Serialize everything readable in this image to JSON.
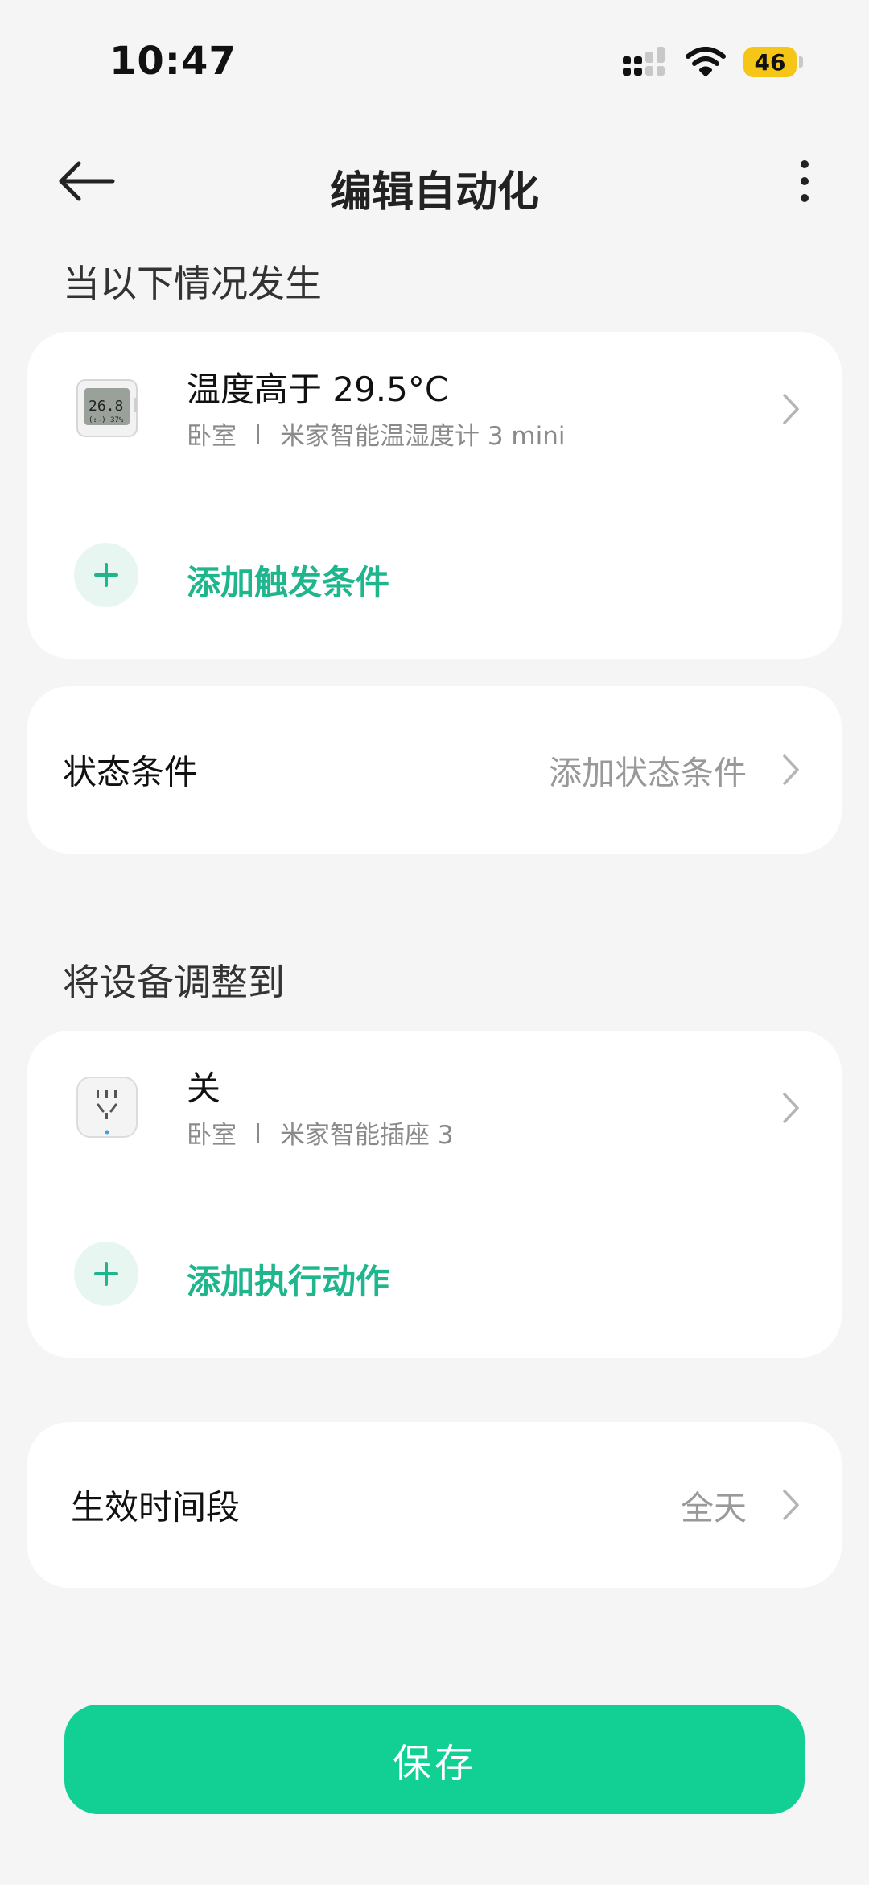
{
  "status_bar": {
    "time": "10:47",
    "battery": "46",
    "icons": [
      "signal-icon",
      "wifi-icon",
      "battery-icon"
    ]
  },
  "header": {
    "title": "编辑自动化",
    "back_icon": "arrow-left-icon",
    "more_icon": "more-vertical-icon"
  },
  "trigger_section": {
    "label": "当以下情况发生",
    "item": {
      "title": "温度高于 29.5°C",
      "room": "卧室",
      "device": "米家智能温湿度计 3 mini",
      "icon": "thermometer-icon"
    },
    "add_label": "添加触发条件"
  },
  "state_section": {
    "label": "状态条件",
    "value": "添加状态条件"
  },
  "action_section": {
    "label": "将设备调整到",
    "item": {
      "title": "关",
      "room": "卧室",
      "device": "米家智能插座 3",
      "icon": "smart-plug-icon"
    },
    "add_label": "添加执行动作"
  },
  "time_section": {
    "label": "生效时间段",
    "value": "全天"
  },
  "save_label": "保存",
  "colors": {
    "accent": "#12cf93",
    "accent_text": "#1fb58d",
    "background": "#f5f5f5"
  }
}
